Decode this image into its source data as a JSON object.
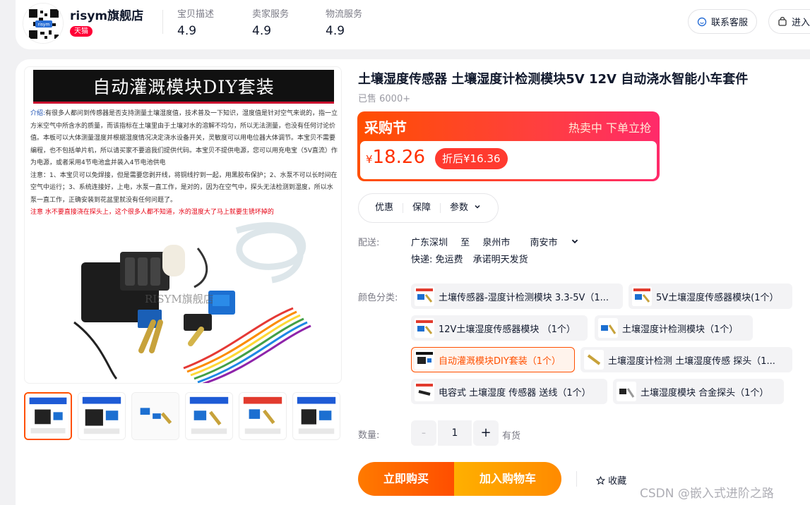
{
  "shop": {
    "name": "risym旗舰店",
    "badge": "天猫",
    "ratings": [
      {
        "label": "宝贝描述",
        "value": "4.9"
      },
      {
        "label": "卖家服务",
        "value": "4.9"
      },
      {
        "label": "物流服务",
        "value": "4.9"
      }
    ],
    "contact_label": "联系客服",
    "enter_label": "进入"
  },
  "gallery": {
    "banner_text": "自动灌溉模块DIY套装",
    "intro_label": "介绍:",
    "intro_text": "有很多人都问到传感器是否支持测量土壤湿度值，技术普及一下知识，湿度值是针对空气来说的，指一立方米空气中所含水的质量，而该指标在土壤里由于土壤对水的溶解不均匀，所以无法测量，也没有任何讨论价值。本板可以大体测量湿度并根据湿度情况决定浇水设备开关，灵敏度可以用电位器大体调节。本宝贝不需要编程，也不包括单片机，所以请买家不要追我们提供代码。本宝贝不提供电源，您可以用充电宝（5V直流）作为电源，或者采用4节电池盒并装入4节电池供电",
    "note_text": "注意：1、本宝贝可以免焊接，但是需要您剥开线，将铜线拧到一起，用黑胶布保护；2、水泵不可以长时间在空气中运行；3、系统连接好，上电，水泵一直工作，是对的，因为在空气中，探头无法检测到湿度，所以水泵一直工作，正确安装到花盆里就没有任何问题了。",
    "warning_text": "注意 水不要直接浇在探头上，这个很多人都不知道，水的湿度大了马上就要生锈坏掉的",
    "watermark": "RISYM旗舰店"
  },
  "product": {
    "title": "土壤湿度传感器 土壤湿度计检测模块5V 12V 自动浇水智能小车套件",
    "sold": "已售 6000+"
  },
  "promo": {
    "name": "采购节",
    "slogan": "热卖中 下单立抢",
    "currency": "¥",
    "price": "18.26",
    "after_price": "折后¥16.36"
  },
  "tabs": [
    "优惠",
    "保障",
    "参数"
  ],
  "shipping": {
    "label": "配送:",
    "from": "广东深圳",
    "to_word": "至",
    "city": "泉州市",
    "district": "南安市",
    "express": "快递: 免运费",
    "promise": "承诺明天发货"
  },
  "options": {
    "label": "颜色分类:",
    "items": [
      "土壤传感器-湿度计检测模块 3.3-5V（1...",
      "5V土壤湿度传感器模块(1个）",
      "12V土壤湿度传感器模块 （1个）",
      "土壤湿度计检测模块（1个）",
      "自动灌溉模块DIY套装（1个）",
      "土壤湿度计检测 土壤湿度传感 探头（1...",
      "电容式 土壤湿度 传感器 送线（1个）",
      "土壤湿度模块 合金探头（1个）"
    ]
  },
  "quantity": {
    "label": "数量:",
    "minus": "-",
    "value": "1",
    "plus": "+",
    "stock": "有货"
  },
  "actions": {
    "buy_now": "立即购买",
    "add_cart": "加入购物车",
    "favorite": "收藏"
  },
  "watermark": "CSDN @嵌入式进阶之路",
  "colors": {
    "accent": "#ff5000",
    "tmall": "#ff0036",
    "price": "#ff3000"
  }
}
